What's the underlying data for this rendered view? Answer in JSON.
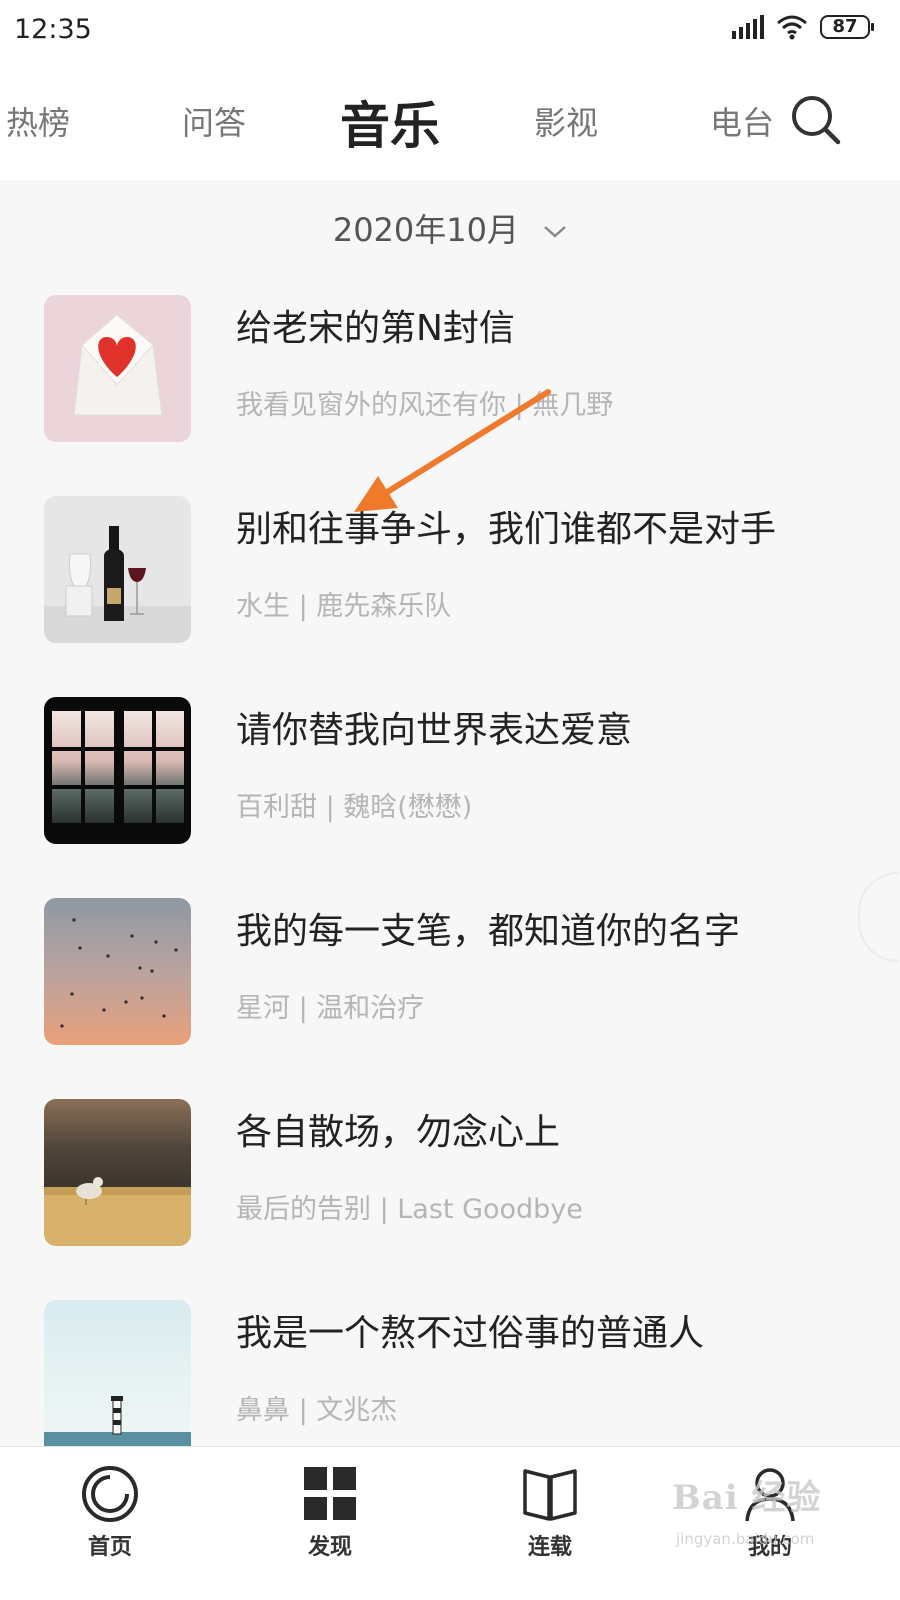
{
  "status_bar": {
    "time": "12:35",
    "battery": "87"
  },
  "top_tabs": {
    "tabs": [
      "热榜",
      "问答",
      "音乐",
      "影视",
      "电台"
    ],
    "active": "音乐"
  },
  "date_selector": {
    "value": "2020年10月"
  },
  "songs": [
    {
      "title": "给老宋的第N封信",
      "subtitle": "我看见窗外的风还有你 | 無几野",
      "thumb": "envelope-heart"
    },
    {
      "title": "别和往事争斗，我们谁都不是对手",
      "subtitle": "水生 | 鹿先森乐队",
      "thumb": "wine-bottle"
    },
    {
      "title": "请你替我向世界表达爱意",
      "subtitle": "百利甜 | 魏晗(懋懋)",
      "thumb": "window-frost"
    },
    {
      "title": "我的每一支笔，都知道你的名字",
      "subtitle": "星河 | 温和治疗",
      "thumb": "birds-sky"
    },
    {
      "title": "各自散场，勿念心上",
      "subtitle": "最后的告别 | Last Goodbye",
      "thumb": "bird-on-sand"
    },
    {
      "title": "我是一个熬不过俗事的普通人",
      "subtitle": "鼻鼻 | 文兆杰",
      "thumb": "lighthouse-sea"
    }
  ],
  "bottom_nav": {
    "items": [
      {
        "label": "首页",
        "icon": "home-ring-icon"
      },
      {
        "label": "发现",
        "icon": "grid-icon"
      },
      {
        "label": "连载",
        "icon": "book-icon"
      },
      {
        "label": "我的",
        "icon": "person-icon"
      }
    ]
  },
  "watermark": {
    "text": "Bai 经验",
    "sub": "jingyan.baidu.com"
  },
  "colors": {
    "arrow": "#f07a2c",
    "heart": "#e0312b"
  }
}
